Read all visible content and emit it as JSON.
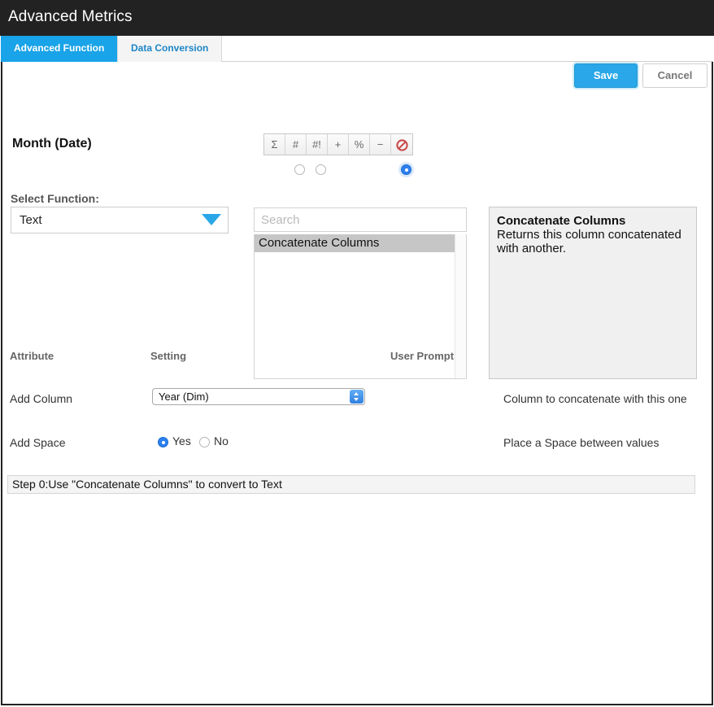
{
  "window": {
    "title": "Advanced Metrics"
  },
  "tabs": [
    {
      "label": "Advanced Function",
      "active": true
    },
    {
      "label": "Data Conversion",
      "active": false
    }
  ],
  "actions": {
    "save_label": "Save",
    "cancel_label": "Cancel",
    "save_color": "#29a7e8"
  },
  "column": {
    "label": "Month (Date)"
  },
  "type_toolbar": {
    "buttons": [
      {
        "name": "sum-icon",
        "glyph": "Σ"
      },
      {
        "name": "number-icon",
        "glyph": "#"
      },
      {
        "name": "number-exclaim-icon",
        "glyph": "#!"
      },
      {
        "name": "plus-icon",
        "glyph": "+"
      },
      {
        "name": "percent-icon",
        "glyph": "%"
      },
      {
        "name": "minus-icon",
        "glyph": "−"
      },
      {
        "name": "prohibited-icon",
        "glyph": "⃠"
      }
    ],
    "radios": [
      {
        "name": "type-radio-1",
        "checked": false
      },
      {
        "name": "type-radio-2",
        "checked": false
      },
      {
        "name": "type-radio-3",
        "checked": true
      }
    ]
  },
  "select_function": {
    "label": "Select Function:",
    "value": "Text"
  },
  "search": {
    "placeholder": "Search",
    "value": ""
  },
  "function_list": {
    "items": [
      {
        "label": "Concatenate Columns",
        "selected": true
      }
    ]
  },
  "description": {
    "title": "Concatenate Columns",
    "body": "Returns this column concatenated with another."
  },
  "attribute_table": {
    "headers": {
      "attribute": "Attribute",
      "setting": "Setting",
      "user_prompt": "User Prompt"
    },
    "rows": [
      {
        "attribute": "Add Column",
        "setting_type": "select",
        "setting_value": "Year (Dim)",
        "user_prompt": "Column to concatenate with this one"
      },
      {
        "attribute": "Add Space",
        "setting_type": "radio",
        "options": [
          {
            "label": "Yes",
            "checked": true
          },
          {
            "label": "No",
            "checked": false
          }
        ],
        "user_prompt": "Place a Space between values"
      }
    ]
  },
  "step_bar": {
    "text": "Step 0:Use \"Concatenate Columns\" to convert to Text"
  }
}
